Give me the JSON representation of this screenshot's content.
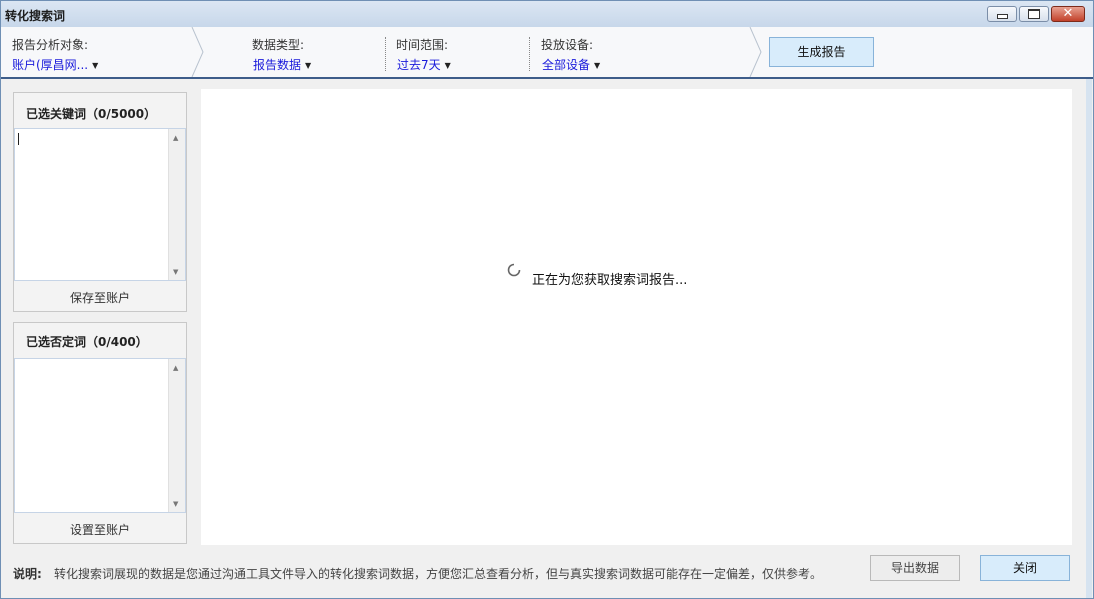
{
  "window": {
    "title": "转化搜索词"
  },
  "toolbar": {
    "report_target": {
      "label": "报告分析对象:",
      "value": "账户(厚昌网..."
    },
    "data_type": {
      "label": "数据类型:",
      "value": "报告数据"
    },
    "time_range": {
      "label": "时间范围:",
      "value": "过去7天"
    },
    "device": {
      "label": "投放设备:",
      "value": "全部设备"
    },
    "generate_label": "生成报告"
  },
  "keywords_panel": {
    "title": "已选关键词（0/5000）",
    "value": "",
    "save_label": "保存至账户"
  },
  "negative_panel": {
    "title": "已选否定词（0/400）",
    "value": "",
    "save_label": "设置至账户"
  },
  "main": {
    "loading_text": "正在为您获取搜索词报告..."
  },
  "footer": {
    "note_label": "说明:",
    "note_text": "转化搜索词展现的数据是您通过沟通工具文件导入的转化搜索词数据，方便您汇总查看分析，但与真实搜索词数据可能存在一定偏差，仅供参考。",
    "export_label": "导出数据",
    "close_label": "关闭"
  },
  "colors": {
    "accent": "#3e5d8a",
    "link": "#1a1adb",
    "button_bg": "#d8ecfb"
  },
  "icons": [
    "minimize-icon",
    "maximize-icon",
    "close-icon",
    "dropdown-caret-icon",
    "loading-spinner-icon"
  ]
}
